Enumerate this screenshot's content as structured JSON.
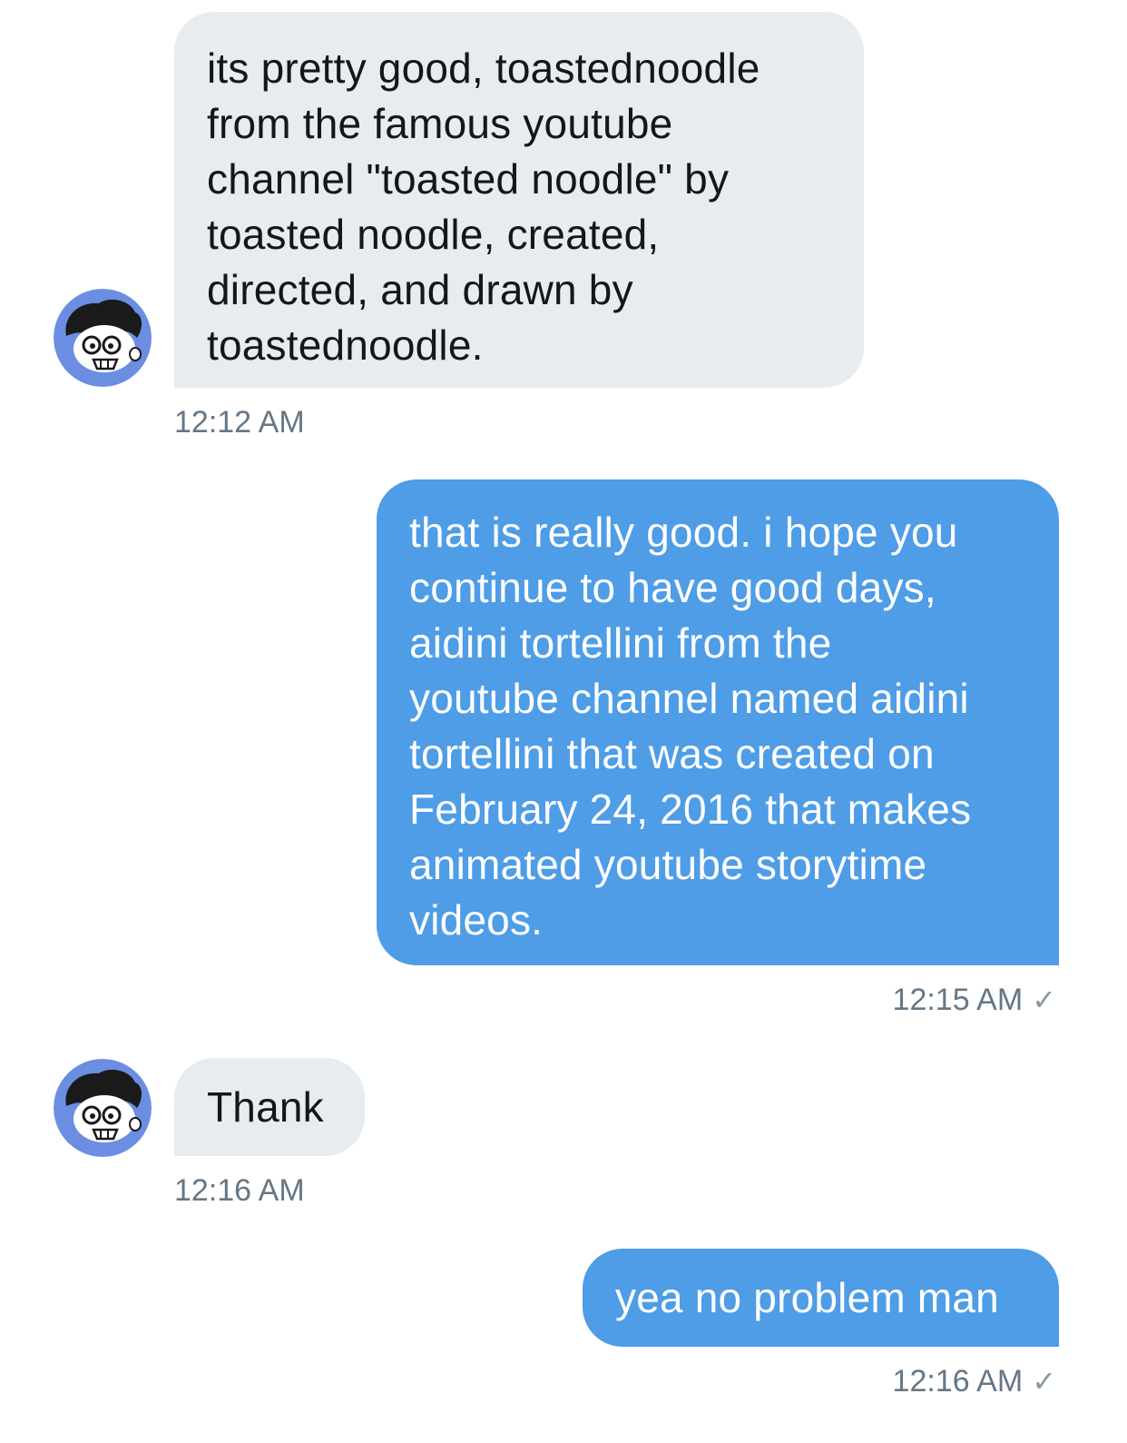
{
  "messages": [
    {
      "direction": "incoming",
      "lines": [
        "its pretty good, toastednoodle",
        "from the famous youtube",
        "channel \"toasted noodle\" by",
        "toasted noodle, created,",
        "directed, and drawn by",
        "toastednoodle."
      ],
      "time": "12:12 AM"
    },
    {
      "direction": "outgoing",
      "lines": [
        "that is really good. i hope you",
        "continue to have good days,",
        "aidini tortellini from the",
        "youtube channel named aidini",
        "tortellini that was created on",
        "February 24, 2016 that makes",
        "animated youtube storytime",
        "videos."
      ],
      "time": "12:15 AM",
      "status_icon": "checkmark-icon"
    },
    {
      "direction": "incoming",
      "lines": [
        "Thank"
      ],
      "time": "12:16 AM"
    },
    {
      "direction": "outgoing",
      "lines": [
        "yea no problem man"
      ],
      "time": "12:16 AM",
      "status_icon": "checkmark-icon"
    }
  ],
  "colors": {
    "incoming_bubble": "#e6ecf0",
    "outgoing_bubble": "#4e9de6",
    "timestamp": "#657786",
    "avatar_bg": "#6b8ee3"
  },
  "icons": {
    "check": "✓"
  }
}
